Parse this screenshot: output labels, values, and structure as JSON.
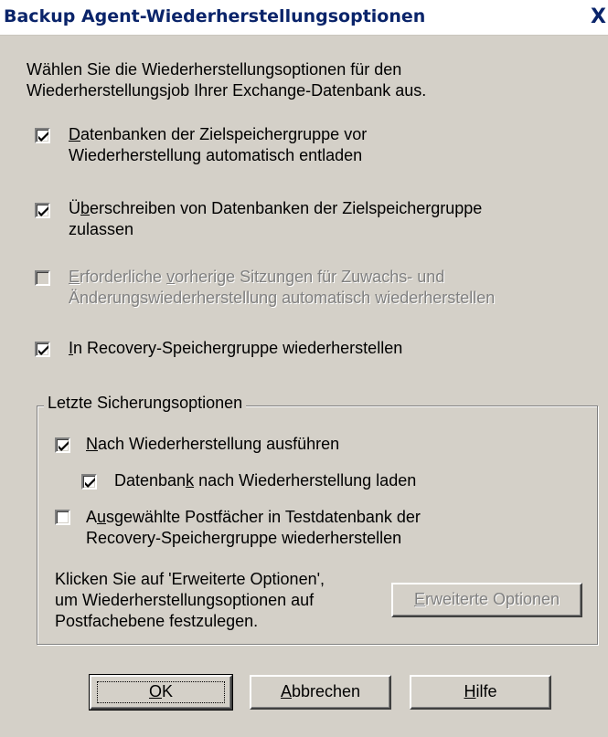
{
  "window": {
    "title": "Backup Agent-Wiederherstellungsoptionen",
    "close_glyph": "X"
  },
  "intro": {
    "line1": "Wählen Sie die Wiederherstellungsoptionen für den",
    "line2": "Wiederherstellungsjob Ihrer Exchange-Datenbank aus."
  },
  "options": [
    {
      "key": "D",
      "line1_rest": "atenbanken der Zielspeichergruppe vor",
      "line2": "Wiederherstellung automatisch entladen",
      "checked": true,
      "enabled": true
    },
    {
      "pre": "Ü",
      "key": "b",
      "line1_rest": "erschreiben von Datenbanken der Zielspeichergruppe",
      "line2": "zulassen",
      "checked": true,
      "enabled": true
    },
    {
      "key": "E",
      "line1_mid": "rforderliche ",
      "key2": "v",
      "line1_rest": "orherige Sitzungen für Zuwachs- und",
      "line2": "Änderungswiederherstellung automatisch wiederherstellen",
      "checked": false,
      "enabled": false
    },
    {
      "key": "I",
      "line1_rest": "n Recovery-Speichergruppe wiederherstellen",
      "checked": true,
      "enabled": true
    }
  ],
  "group": {
    "legend": "Letzte Sicherungsoptionen",
    "run_after": {
      "key": "N",
      "rest": "ach Wiederherstellung ausführen",
      "checked": true
    },
    "load_db": {
      "pre": "Datenban",
      "key": "k",
      "rest": " nach Wiederherstellung laden",
      "checked": true
    },
    "mailboxes": {
      "pre": "A",
      "key": "u",
      "rest": "sgewählte Postfächer in Testdatenbank der",
      "line2": "Recovery-Speichergruppe wiederherstellen",
      "checked": false
    },
    "hint": {
      "line1": "Klicken Sie auf 'Erweiterte Optionen',",
      "line2": "um Wiederherstellungsoptionen auf",
      "line3": "Postfachebene festzulegen."
    },
    "advanced_button": {
      "key": "E",
      "rest": "rweiterte Optionen"
    }
  },
  "buttons": {
    "ok": {
      "key": "O",
      "rest": "K"
    },
    "cancel": {
      "key": "A",
      "rest": "bbrechen"
    },
    "help": {
      "key": "H",
      "rest": "ilfe"
    }
  }
}
